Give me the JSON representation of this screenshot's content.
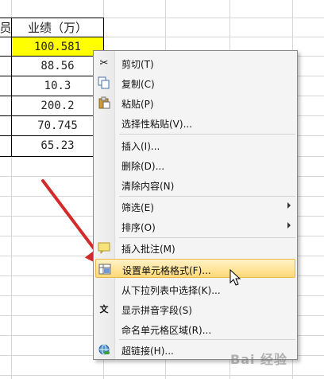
{
  "sheet": {
    "header_partial": "员",
    "column_header": "业绩（万）",
    "values": [
      "100.581",
      "88.56",
      "10.3",
      "200.2",
      "70.745",
      "65.23"
    ]
  },
  "menu": {
    "items": [
      {
        "label": "剪切(T)",
        "icon": "scissors-icon"
      },
      {
        "label": "复制(C)",
        "icon": "copy-icon"
      },
      {
        "label": "粘贴(P)",
        "icon": "paste-icon"
      },
      {
        "label": "选择性粘贴(V)..."
      },
      {
        "label": "插入(I)..."
      },
      {
        "label": "删除(D)..."
      },
      {
        "label": "清除内容(N)"
      },
      {
        "label": "筛选(E)",
        "submenu": true
      },
      {
        "label": "排序(O)",
        "submenu": true
      },
      {
        "label": "插入批注(M)",
        "icon": "comment-icon"
      },
      {
        "label": "设置单元格格式(F)...",
        "icon": "format-cells-icon",
        "highlighted": true
      },
      {
        "label": "从下拉列表中选择(K)..."
      },
      {
        "label": "显示拼音字段(S)",
        "icon": "phonetic-icon"
      },
      {
        "label": "命名单元格区域(R)..."
      },
      {
        "label": "超链接(H)...",
        "icon": "hyperlink-icon"
      }
    ]
  },
  "annotation": {
    "arrow_color": "#d32b2b"
  },
  "watermark": "Bai 经验"
}
